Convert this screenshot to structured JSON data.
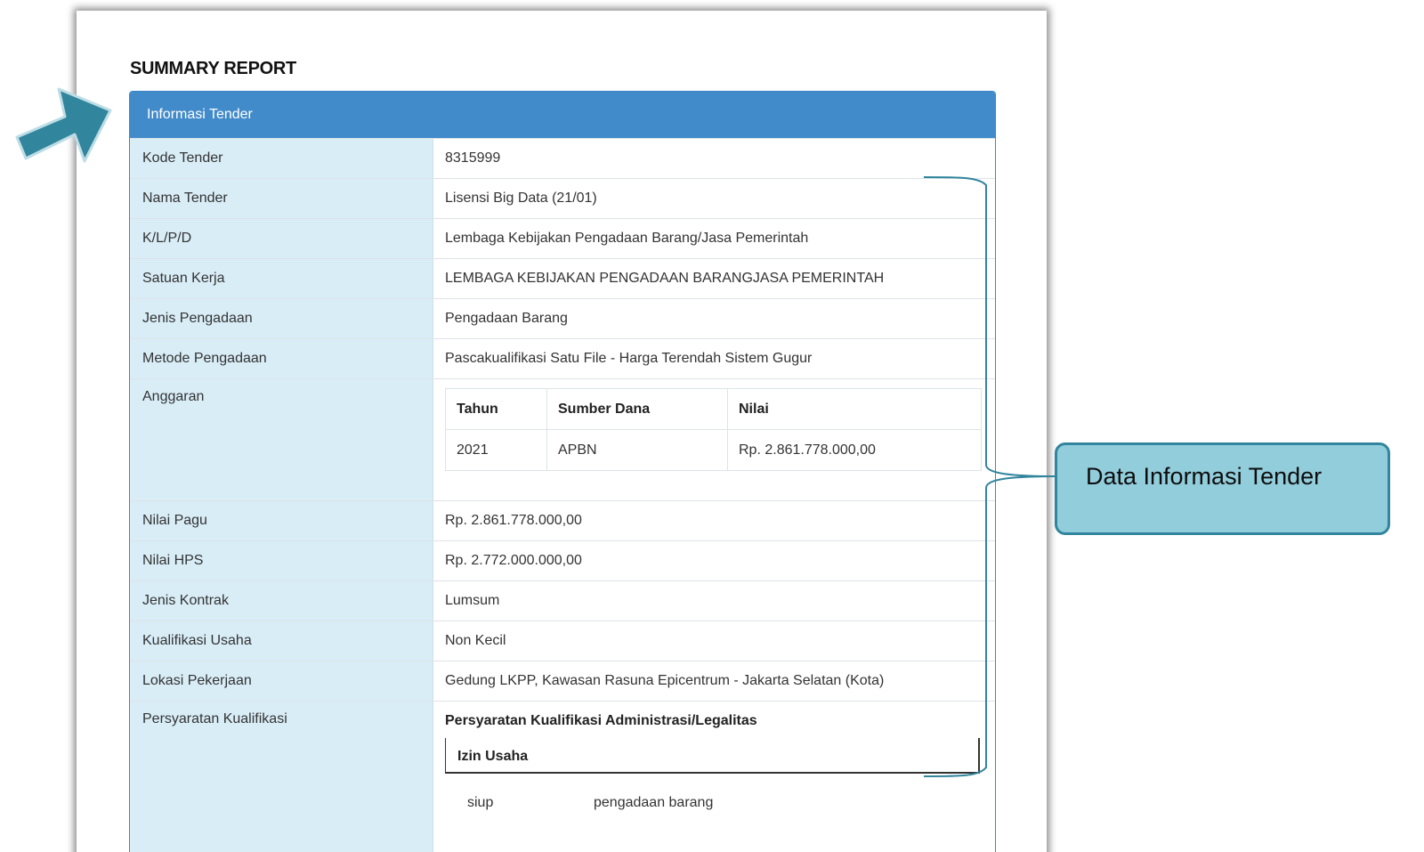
{
  "report_title": "SUMMARY REPORT",
  "panel": {
    "heading": "Informasi Tender",
    "rows": [
      {
        "label": "Kode Tender",
        "value": "8315999"
      },
      {
        "label": "Nama Tender",
        "value": "Lisensi Big Data (21/01)"
      },
      {
        "label": "K/L/P/D",
        "value": "Lembaga Kebijakan Pengadaan Barang/Jasa Pemerintah"
      },
      {
        "label": "Satuan Kerja",
        "value": "LEMBAGA KEBIJAKAN PENGADAAN BARANGJASA PEMERINTAH"
      },
      {
        "label": "Jenis Pengadaan",
        "value": "Pengadaan Barang"
      },
      {
        "label": "Metode Pengadaan",
        "value": "Pascakualifikasi Satu File - Harga Terendah Sistem Gugur"
      }
    ],
    "anggaran": {
      "label": "Anggaran",
      "headers": [
        "Tahun",
        "Sumber Dana",
        "Nilai"
      ],
      "row": [
        "2021",
        "APBN",
        "Rp. 2.861.778.000,00"
      ]
    },
    "rows2": [
      {
        "label": "Nilai Pagu",
        "value": "Rp. 2.861.778.000,00"
      },
      {
        "label": "Nilai HPS",
        "value": "Rp. 2.772.000.000,00"
      },
      {
        "label": "Jenis Kontrak",
        "value": "Lumsum"
      },
      {
        "label": "Kualifikasi Usaha",
        "value": "Non Kecil"
      },
      {
        "label": "Lokasi Pekerjaan",
        "value": "Gedung LKPP, Kawasan Rasuna Epicentrum - Jakarta Selatan (Kota)"
      }
    ],
    "persyaratan": {
      "label": "Persyaratan Kualifikasi",
      "title": "Persyaratan Kualifikasi Administrasi/Legalitas",
      "box_title": "Izin Usaha",
      "item_type": "siup",
      "item_desc": "pengadaan barang"
    }
  },
  "callout": {
    "text": "Data Informasi Tender",
    "fill": "#92cddc",
    "border": "#31859c"
  },
  "colors": {
    "panel_header": "#428bca",
    "label_bg": "#d9edf7",
    "arrow": "#31859c"
  },
  "icons": [
    "arrow-pointer-icon",
    "bracket-icon"
  ]
}
